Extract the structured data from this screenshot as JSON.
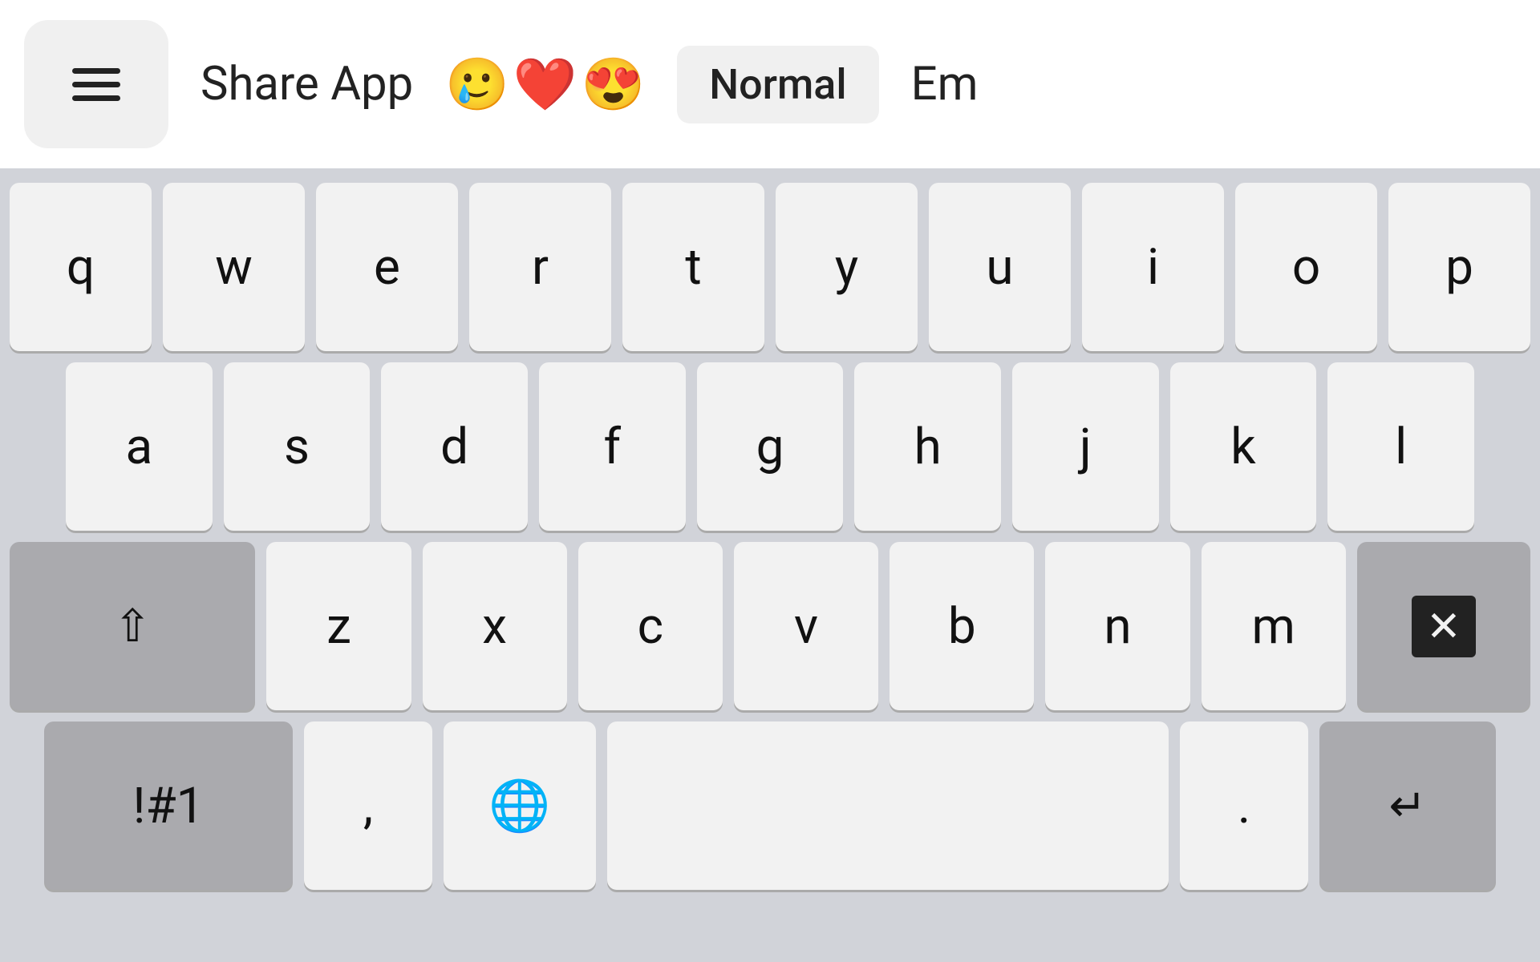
{
  "topbar": {
    "share_app_label": "Share App",
    "normal_label": "Normal",
    "em_label": "Em",
    "emojis": [
      "🥲",
      "❤️",
      "😍"
    ]
  },
  "keyboard": {
    "rows": [
      [
        "q",
        "w",
        "e",
        "r",
        "t",
        "y",
        "u",
        "i",
        "o",
        "p"
      ],
      [
        "a",
        "s",
        "d",
        "f",
        "g",
        "h",
        "j",
        "k",
        "l"
      ],
      [
        "⇧",
        "z",
        "x",
        "c",
        "v",
        "b",
        "n",
        "m",
        "⌫"
      ],
      [
        "!#1",
        ",",
        "🌐",
        " ",
        ".",
        "↵"
      ]
    ]
  }
}
